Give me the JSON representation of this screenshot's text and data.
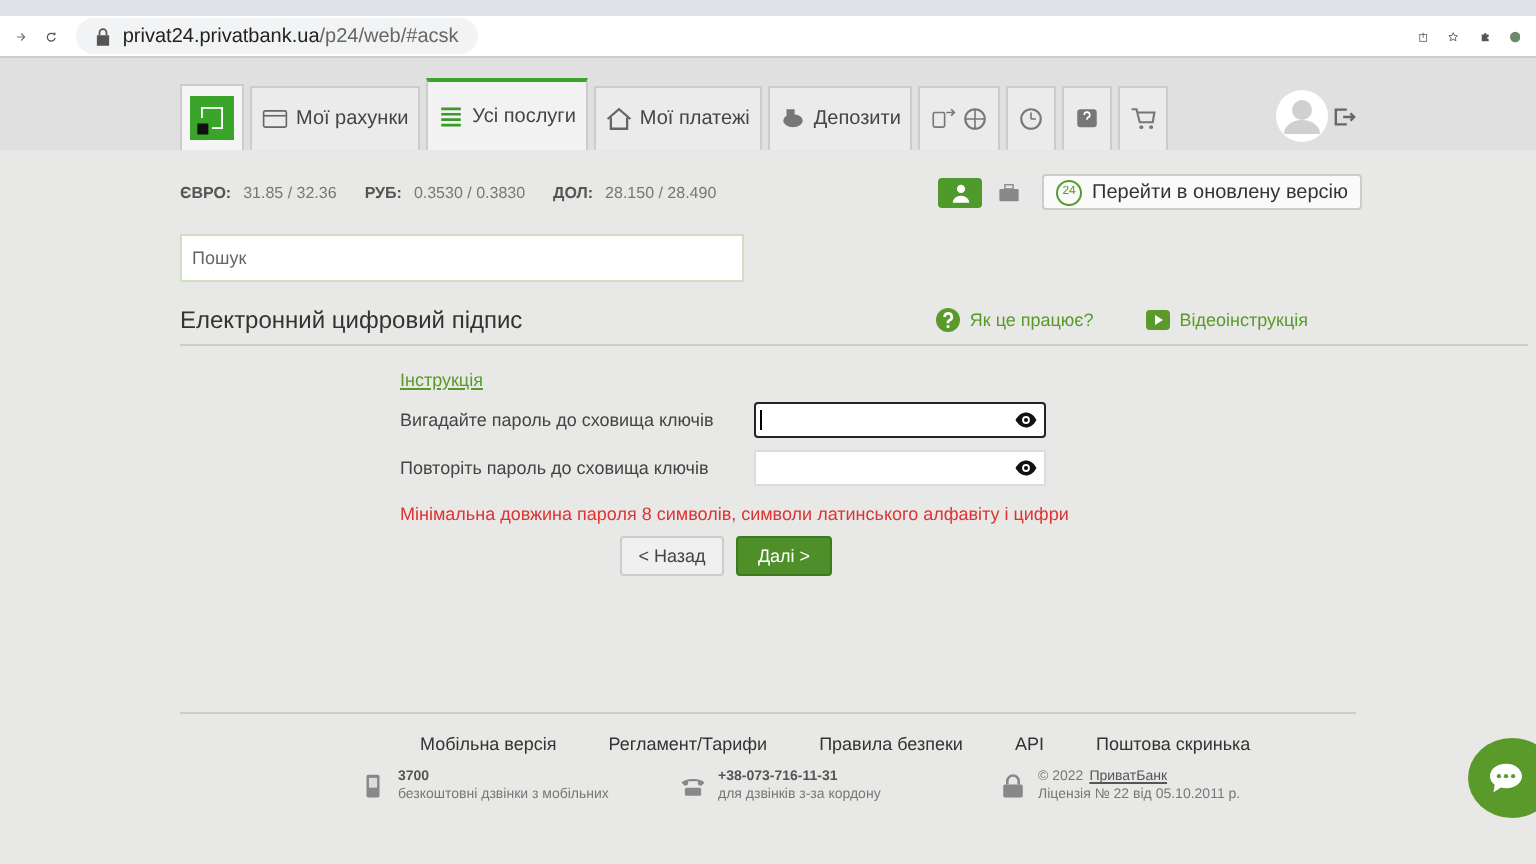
{
  "browser": {
    "url_host": "privat24.privatbank.ua",
    "url_path": "/p24/web/#acsk"
  },
  "nav": {
    "tabs": [
      {
        "kind": "logo"
      },
      {
        "kind": "tab",
        "label": "Мої рахунки",
        "selected": false
      },
      {
        "kind": "tab",
        "label": "Усі послуги",
        "selected": true
      },
      {
        "kind": "tab",
        "label": "Мої платежі",
        "selected": false
      },
      {
        "kind": "tab",
        "label": "Депозити",
        "selected": false
      },
      {
        "kind": "icons",
        "selected": false
      },
      {
        "kind": "icons",
        "selected": false
      },
      {
        "kind": "icons",
        "selected": false
      },
      {
        "kind": "icons",
        "selected": false
      }
    ]
  },
  "rates": [
    {
      "label": "ЄВРО:",
      "value": "31.85 / 32.36"
    },
    {
      "label": "РУБ:",
      "value": "0.3530 / 0.3830"
    },
    {
      "label": "ДОЛ:",
      "value": "28.150 / 28.490"
    }
  ],
  "mode_toggle": [
    {
      "selected": true
    },
    {
      "selected": false
    }
  ],
  "new_version": {
    "badge": "24",
    "label": "Перейти в оновлену версію"
  },
  "search": {
    "placeholder": "Пошук"
  },
  "section": {
    "title": "Електронний цифровий підпис",
    "help_link": "Як це працює?",
    "video_link": "Відеоінструкція"
  },
  "form": {
    "instruction_link": "Інструкція",
    "fields": [
      {
        "label": "Вигадайте пароль до сховища ключів",
        "focused": true
      },
      {
        "label": "Повторіть пароль до сховища ключів",
        "focused": false
      }
    ],
    "error": "Мінімальна довжина пароля 8 символів, символи латинського алфавіту і цифри",
    "back": "< Назад",
    "next": "Далі >"
  },
  "footer": {
    "links": [
      "Мобільна версія",
      "Регламент/Тарифи",
      "Правила безпеки",
      "API",
      "Поштова скринька"
    ],
    "contacts": [
      {
        "title": "3700",
        "subtitle": "безкоштовні дзвінки з мобільних"
      },
      {
        "title": "+38-073-716-11-31",
        "subtitle": "для дзвінків з-за кордону"
      }
    ],
    "copyright": "© 2022",
    "bank_link": "ПриватБанк",
    "licence": "Ліцензія № 22 від 05.10.2011 р."
  }
}
